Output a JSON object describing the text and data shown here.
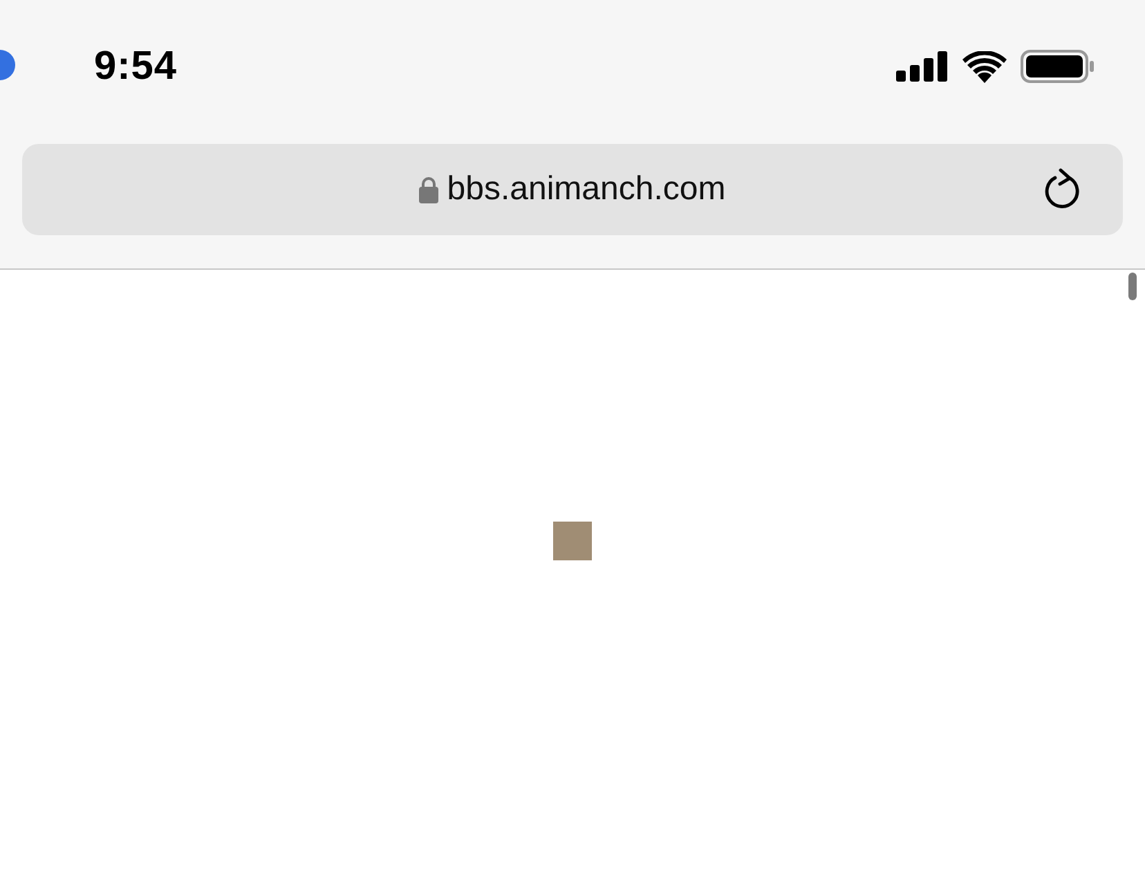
{
  "status_bar": {
    "time": "9:54"
  },
  "address_bar": {
    "url": "bbs.animanch.com"
  }
}
